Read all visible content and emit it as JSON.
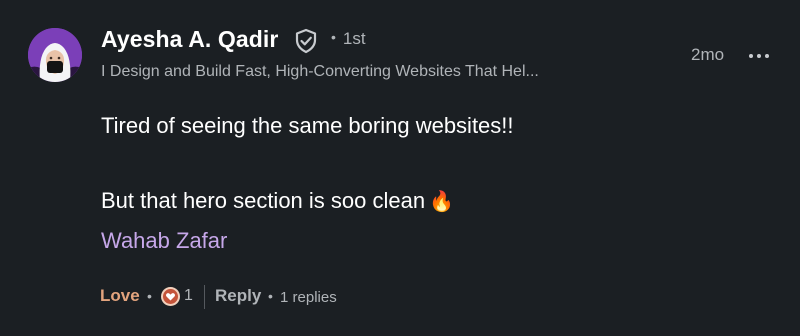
{
  "author": {
    "name": "Ayesha A. Qadir",
    "degree": "1st",
    "headline": "I Design and Build Fast, High-Converting Websites That Hel..."
  },
  "timestamp": "2mo",
  "comment": {
    "line1": "Tired of seeing the same boring websites!!",
    "line2": "But that hero section is soo clean",
    "emoji": "🔥",
    "mention": "Wahab Zafar"
  },
  "actions": {
    "love_label": "Love",
    "reaction_count": "1",
    "reply_label": "Reply",
    "replies_text": "1 replies",
    "separator": "•"
  },
  "icons": {
    "verify": "verified-shield-icon",
    "more": "more-horizontal-icon",
    "reaction": "love-heart-icon"
  },
  "colors": {
    "background": "#1b1f23",
    "love": "#e3a47e",
    "mention": "#c6a7e9",
    "muted": "#b0b4b8"
  }
}
